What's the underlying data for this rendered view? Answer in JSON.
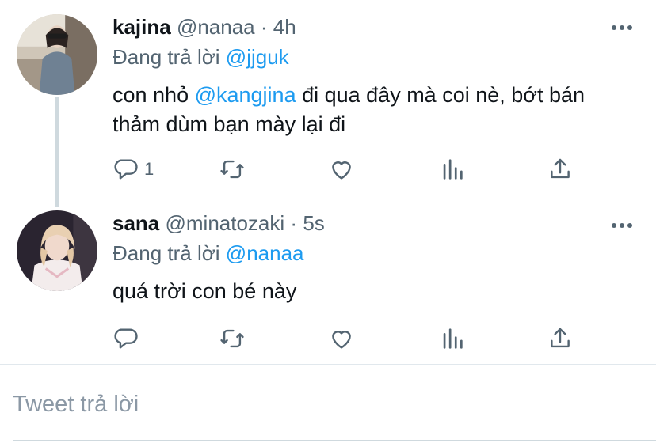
{
  "tweets": [
    {
      "display_name": "kajina",
      "handle": "@nanaa",
      "separator": "·",
      "time": "4h",
      "replying_prefix": "Đang trả lời",
      "replying_to": "@jjguk",
      "text_before": "con nhỏ ",
      "text_mention": "@kangjina",
      "text_after": " đi qua đây mà coi nè, bớt bán thảm dùm bạn mày lại đi",
      "reply_count": "1"
    },
    {
      "display_name": "sana",
      "handle": "@minatozaki",
      "separator": "·",
      "time": "5s",
      "replying_prefix": "Đang trả lời",
      "replying_to": "@nanaa",
      "text_before": "quá trời con bé này",
      "text_mention": "",
      "text_after": "",
      "reply_count": ""
    }
  ],
  "compose": {
    "placeholder": "Tweet trả lời"
  },
  "icons": {
    "reply": "reply-icon",
    "retweet": "retweet-icon",
    "like": "heart-icon",
    "stats": "stats-icon",
    "share": "share-icon",
    "more": "more-icon"
  },
  "colors": {
    "text": "#0f1419",
    "muted": "#536471",
    "link": "#1d9bf0",
    "icon": "#536471"
  }
}
